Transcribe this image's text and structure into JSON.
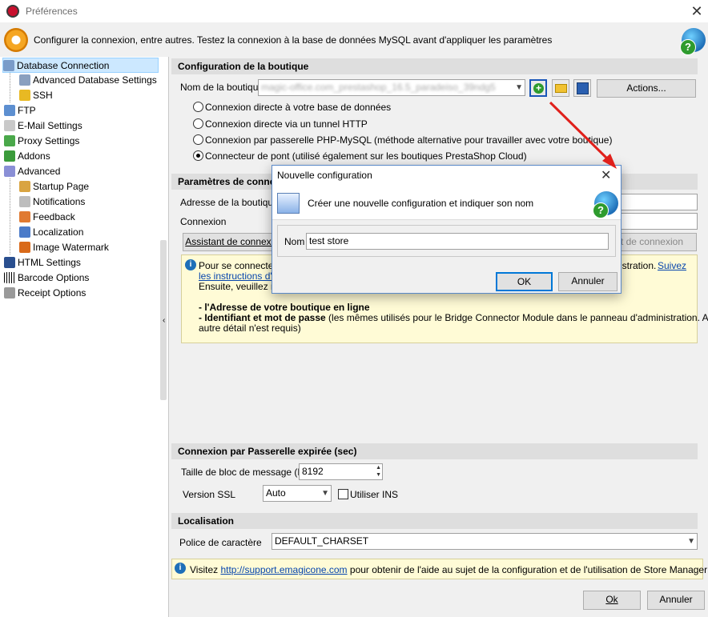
{
  "window": {
    "title": "Préférences",
    "close_glyph": "✕",
    "header_text": "Configurer la connexion, entre autres. Testez la connexion à la base de données MySQL avant d'appliquer les paramètres"
  },
  "sidebar": {
    "items": [
      {
        "label": "Database Connection",
        "icon": "database-icon",
        "selected": true
      },
      {
        "label": "Advanced Database Settings",
        "icon": "database-settings-icon"
      },
      {
        "label": "SSH",
        "icon": "lock-icon"
      },
      {
        "label": "FTP",
        "icon": "ftp-icon"
      },
      {
        "label": "E-Mail Settings",
        "icon": "mail-icon"
      },
      {
        "label": "Proxy Settings",
        "icon": "proxy-icon"
      },
      {
        "label": "Addons",
        "icon": "puzzle-icon"
      },
      {
        "label": "Advanced",
        "icon": "shield-icon"
      },
      {
        "label": "Startup Page",
        "icon": "home-icon"
      },
      {
        "label": "Notifications",
        "icon": "notification-icon"
      },
      {
        "label": "Feedback",
        "icon": "feedback-icon"
      },
      {
        "label": "Localization",
        "icon": "localization-icon"
      },
      {
        "label": "Image Watermark",
        "icon": "image-icon"
      },
      {
        "label": "HTML Settings",
        "icon": "html-icon"
      },
      {
        "label": "Barcode Options",
        "icon": "barcode-icon"
      },
      {
        "label": "Receipt Options",
        "icon": "receipt-icon"
      }
    ],
    "splitter_glyph": "‹"
  },
  "shop_config": {
    "heading": "Configuration de la boutique",
    "shop_name_label": "Nom de la boutique",
    "shop_name_value": "magic-office.com_prestashop_16.5_paradeiso_39ndg5",
    "actions_label": "Actions...",
    "radios": [
      {
        "label": "Connexion directe à votre base de données",
        "checked": false
      },
      {
        "label": "Connexion directe via un tunnel HTTP",
        "checked": false
      },
      {
        "label": "Connexion par passerelle PHP-MySQL (méthode alternative pour travailler avec votre boutique)",
        "checked": false
      },
      {
        "label": "Connecteur de pont (utilisé également sur les boutiques PrestaShop Cloud)",
        "checked": true
      }
    ]
  },
  "connection_params": {
    "heading": "Paramètres de connexion",
    "address_label": "Adresse de la boutique",
    "connexion_label": "Connexion",
    "wizard_label": "Assistant de connexion",
    "test_label": "Test de connexion",
    "info": {
      "line1_start": "Pour se connecter à",
      "line1_end": "istration.",
      "link1": "Suivez",
      "link2": "les instructions d'ins",
      "line2": "Ensuite, veuillez re",
      "bullet1": "- l'Adresse de votre boutique en ligne",
      "bullet2_bold": "- Identifiant et mot de passe",
      "bullet2_rest": " (les mêmes utilisés pour le Bridge Connector Module dans le panneau d'administration. Aucun",
      "bullet2_cont": "autre détail n'est requis)"
    }
  },
  "gateway": {
    "heading": "Connexion par Passerelle expirée (sec)",
    "block_size_label": "Taille de bloc de message (Kb)",
    "block_size_value": "8192",
    "ssl_label": "Version SSL",
    "ssl_value": "Auto",
    "ins_label": "Utiliser INS"
  },
  "localisation": {
    "heading": "Localisation",
    "charset_label": "Police de caractère",
    "charset_value": "DEFAULT_CHARSET"
  },
  "footer_info": {
    "prefix": "Visitez ",
    "link": "http://support.emagicone.com",
    "suffix": " pour obtenir de l'aide au sujet de la configuration et de l'utilisation de Store Manager"
  },
  "bottom_buttons": {
    "ok": "Ok",
    "cancel": "Annuler"
  },
  "dialog": {
    "title": "Nouvelle configuration",
    "header_text": "Créer une nouvelle configuration et indiquer son nom",
    "name_label": "Nom",
    "name_value": "test store",
    "ok": "OK",
    "cancel": "Annuler"
  },
  "colors": {
    "accent": "#0078d7",
    "arrow": "#e0201b",
    "selection": "#cce8ff"
  }
}
